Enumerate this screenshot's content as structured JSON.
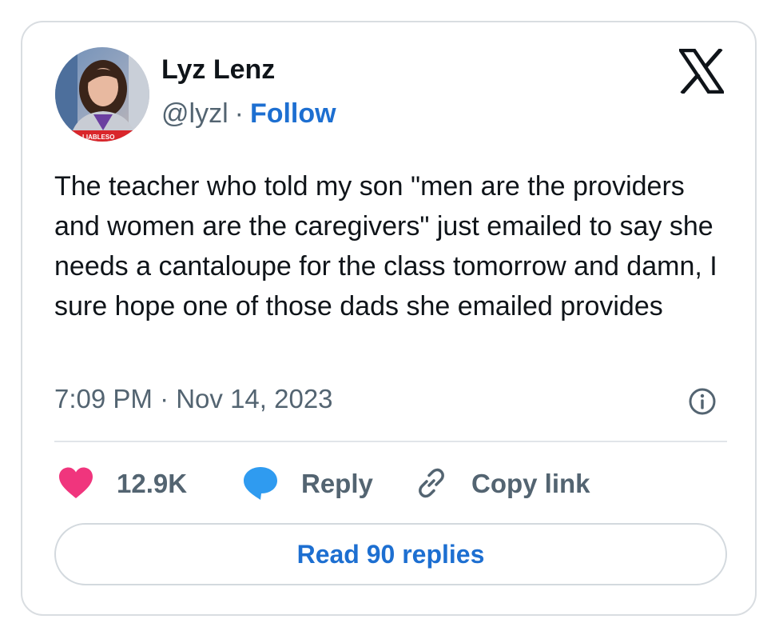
{
  "author": {
    "name": "Lyz Lenz",
    "handle": "@lyzl",
    "separator": "·",
    "follow_label": "Follow",
    "avatar_caption": "LIABLESO"
  },
  "tweet": {
    "text": "The teacher who told my son \"men are the providers and women are the caregivers\" just emailed to say she needs a cantaloupe for the class tomorrow and damn, I sure hope one of those dads she emailed provides",
    "timestamp": "7:09 PM · Nov 14, 2023"
  },
  "actions": {
    "like_count": "12.9K",
    "reply_label": "Reply",
    "copy_link_label": "Copy link"
  },
  "read_replies_label": "Read 90 replies",
  "icons": {
    "brand": "x-logo-icon",
    "info": "info-icon",
    "like": "heart-icon",
    "reply": "speech-bubble-icon",
    "copy": "link-icon"
  },
  "colors": {
    "heart": "#f0357d",
    "reply_bubble": "#2f9bf0",
    "link_blue": "#1d6fd1",
    "secondary_text": "#536471",
    "primary_text": "#0f1419",
    "border": "#d9dde1"
  }
}
